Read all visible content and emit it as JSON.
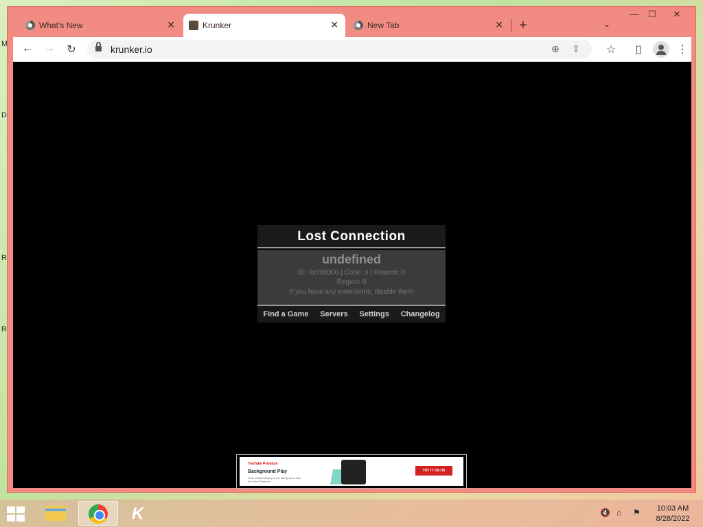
{
  "desktop": {
    "edge_letters": [
      "M",
      "D",
      "R",
      "R"
    ]
  },
  "browser": {
    "tabs": [
      {
        "title": "What's New",
        "active": false
      },
      {
        "title": "Krunker",
        "active": true
      },
      {
        "title": "New Tab",
        "active": false
      }
    ],
    "new_tab_glyph": "+",
    "tab_search_glyph": "⌄",
    "window_controls": {
      "minimize": "—",
      "maximize": "☐",
      "close": "✕"
    },
    "nav": {
      "back": "←",
      "forward": "→",
      "reload": "↻"
    },
    "url": "krunker.io",
    "omnibox_icons": {
      "zoom": "⊕",
      "share": "⇪",
      "bookmark": "☆"
    },
    "side_panel_glyph": "▯",
    "menu_glyph": "⋮"
  },
  "game": {
    "dialog": {
      "title": "Lost Connection",
      "error": "undefined",
      "details": "ID: 0x000000 | Code: 0 | Reason: 0",
      "region": "Region: 0",
      "hint": "If you have any extensions, disable them",
      "menu": [
        "Find a Game",
        "Servers",
        "Settings",
        "Changelog"
      ]
    },
    "ad": {
      "logo": "YouTube Premium",
      "title": "Background Play",
      "subtitle": "Keep videos playing in the background with YouTube Premium",
      "cta": "TRY IT ON US"
    }
  },
  "taskbar": {
    "start_icon": "windows-start",
    "clock": {
      "time": "10:03 AM",
      "date": "8/28/2022"
    },
    "tray": {
      "volume": "🔇",
      "network": "⌂",
      "flag": "⚑"
    }
  }
}
